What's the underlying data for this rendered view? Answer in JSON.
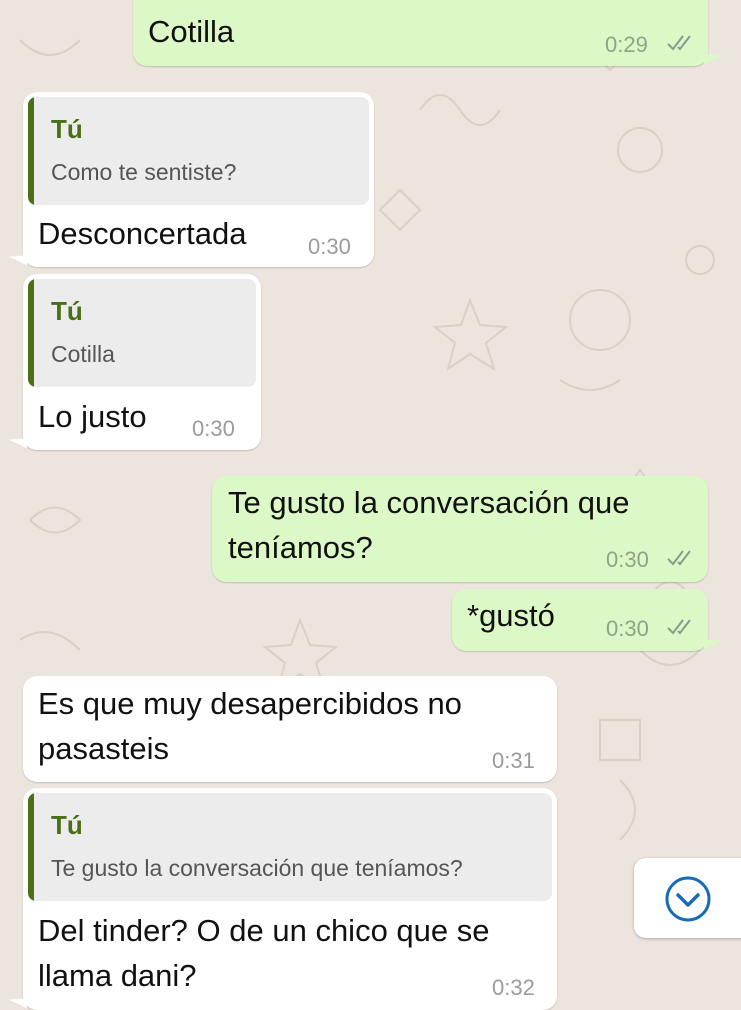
{
  "chat": {
    "messages": [
      {
        "direction": "out",
        "text": "Cotilla",
        "time": "0:29",
        "status": "read"
      },
      {
        "direction": "in",
        "quote": {
          "author": "Tú",
          "text": "Como te sentiste?"
        },
        "text": "Desconcertada",
        "time": "0:30"
      },
      {
        "direction": "in",
        "quote": {
          "author": "Tú",
          "text": "Cotilla"
        },
        "text": "Lo justo",
        "time": "0:30"
      },
      {
        "direction": "out",
        "text_line1": "Te gusto la conversación que",
        "text_line2": "teníamos?",
        "time": "0:30",
        "status": "read"
      },
      {
        "direction": "out",
        "text": "*gustó",
        "time": "0:30",
        "status": "read"
      },
      {
        "direction": "in",
        "text_line1": "Es que muy desapercibidos no",
        "text_line2": "pasasteis",
        "time": "0:31"
      },
      {
        "direction": "in",
        "quote": {
          "author": "Tú",
          "text": "Te gusto la conversación que teníamos?"
        },
        "text_line1": "Del tinder? O de un chico que se",
        "text_line2": "llama dani?",
        "time": "0:32"
      }
    ]
  },
  "colors": {
    "outgoing_bubble": "#dcf8c6",
    "incoming_bubble": "#ffffff",
    "quote_accent": "#4b6f16",
    "scroll_icon": "#1a6bb5"
  },
  "icons": {
    "scroll_down": "chevron-down-circle-icon",
    "read_receipt": "double-check-icon"
  }
}
